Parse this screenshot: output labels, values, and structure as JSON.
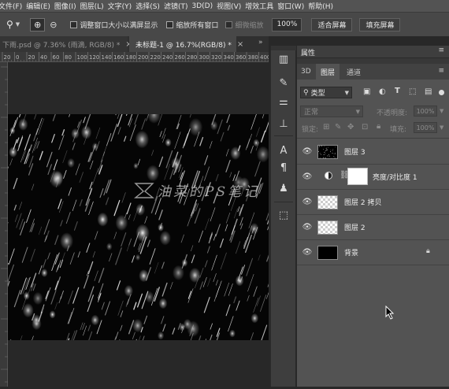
{
  "menu": [
    "文件(F)",
    "编辑(E)",
    "图像(I)",
    "图层(L)",
    "文字(Y)",
    "选择(S)",
    "滤镜(T)",
    "3D(D)",
    "视图(V)",
    "增效工具",
    "窗口(W)",
    "帮助(H)"
  ],
  "options": {
    "fit_window_label": "调整窗口大小以满屏显示",
    "zoom_all_label": "缩放所有窗口",
    "scrubby_label": "细微缩放",
    "zoom_value": "100%",
    "fit_screen_button": "适合屏幕",
    "fill_screen_button": "填充屏幕"
  },
  "tabs": [
    {
      "title": "下雨.psd @ 7.36% (雨滴, RGB/8) *",
      "active": false
    },
    {
      "title": "未标题-1 @ 16.7%(RGB/8) *",
      "active": true
    }
  ],
  "ruler_labels": [
    "20",
    "0",
    "20",
    "40",
    "60",
    "80",
    "100",
    "120",
    "140",
    "160",
    "180",
    "200",
    "220",
    "240",
    "260",
    "280",
    "300",
    "320",
    "340",
    "360",
    "380",
    "400"
  ],
  "watermark": "油菜的PS笔记",
  "panel": {
    "properties_title": "属性",
    "tabs": [
      "3D",
      "图层",
      "通道"
    ],
    "active_tab": "图层",
    "filter_label": "类型",
    "blend_mode": "正常",
    "opacity_label": "不透明度:",
    "opacity_value": "100%",
    "lock_label": "锁定:",
    "fill_label": "填充:",
    "fill_value": "100%"
  },
  "layers": [
    {
      "name": "图层 3",
      "thumb": "noise"
    },
    {
      "name": "亮度/对比度 1",
      "thumb": "adjustment"
    },
    {
      "name": "图层 2 拷贝",
      "thumb": "checker"
    },
    {
      "name": "图层 2",
      "thumb": "checker"
    },
    {
      "name": "背景",
      "thumb": "black",
      "locked": true
    }
  ],
  "colors": {
    "accent": "#2f7fd6",
    "panel": "#535353",
    "canvas": "#050505"
  }
}
